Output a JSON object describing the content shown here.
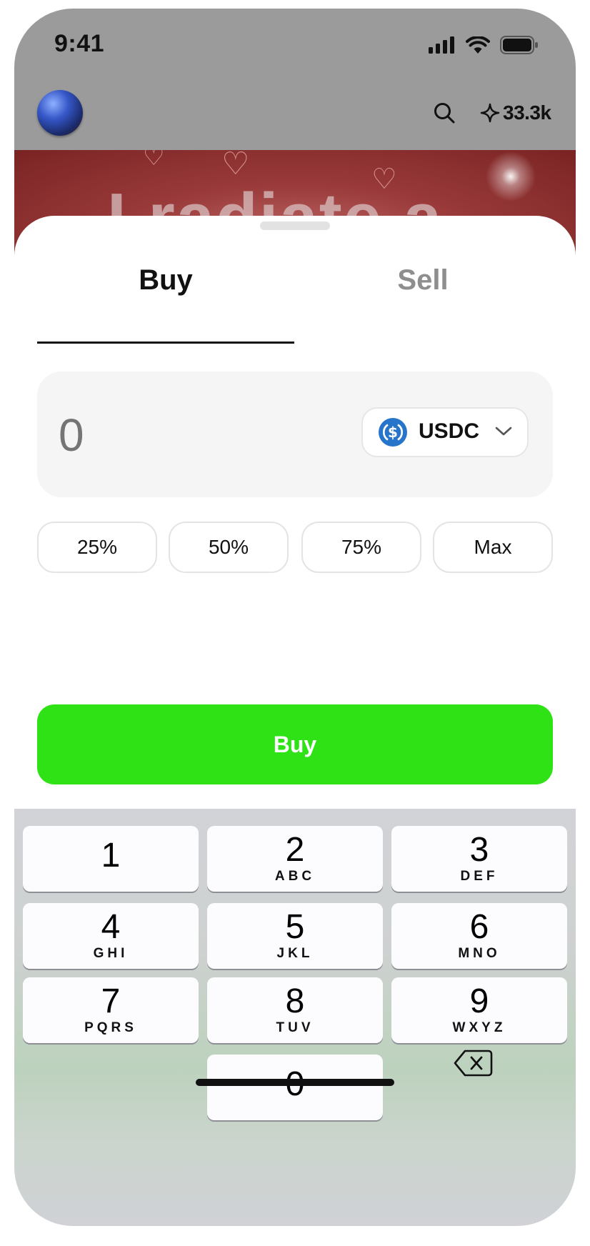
{
  "status_bar": {
    "time": "9:41"
  },
  "app_header": {
    "points": "33.3k",
    "banner_text": "I radiate a"
  },
  "sheet": {
    "tabs": [
      {
        "label": "Buy",
        "active": true
      },
      {
        "label": "Sell",
        "active": false
      }
    ],
    "amount": {
      "placeholder": "0",
      "value": ""
    },
    "token": {
      "symbol": "USDC",
      "icon": "usdc-logo-icon"
    },
    "percent_buttons": [
      "25%",
      "50%",
      "75%",
      "Max"
    ],
    "submit_label": "Buy"
  },
  "keyboard": {
    "keys": [
      {
        "num": "1",
        "letters": ""
      },
      {
        "num": "2",
        "letters": "ABC"
      },
      {
        "num": "3",
        "letters": "DEF"
      },
      {
        "num": "4",
        "letters": "GHI"
      },
      {
        "num": "5",
        "letters": "JKL"
      },
      {
        "num": "6",
        "letters": "MNO"
      },
      {
        "num": "7",
        "letters": "PQRS"
      },
      {
        "num": "8",
        "letters": "TUV"
      },
      {
        "num": "9",
        "letters": "WXYZ"
      },
      {
        "num": "0",
        "letters": ""
      }
    ],
    "delete_icon": "backspace-icon"
  },
  "colors": {
    "accent_green": "#2fe216",
    "usdc_blue": "#2775ca",
    "text_primary": "#111111",
    "text_muted": "#8e8e8e"
  }
}
